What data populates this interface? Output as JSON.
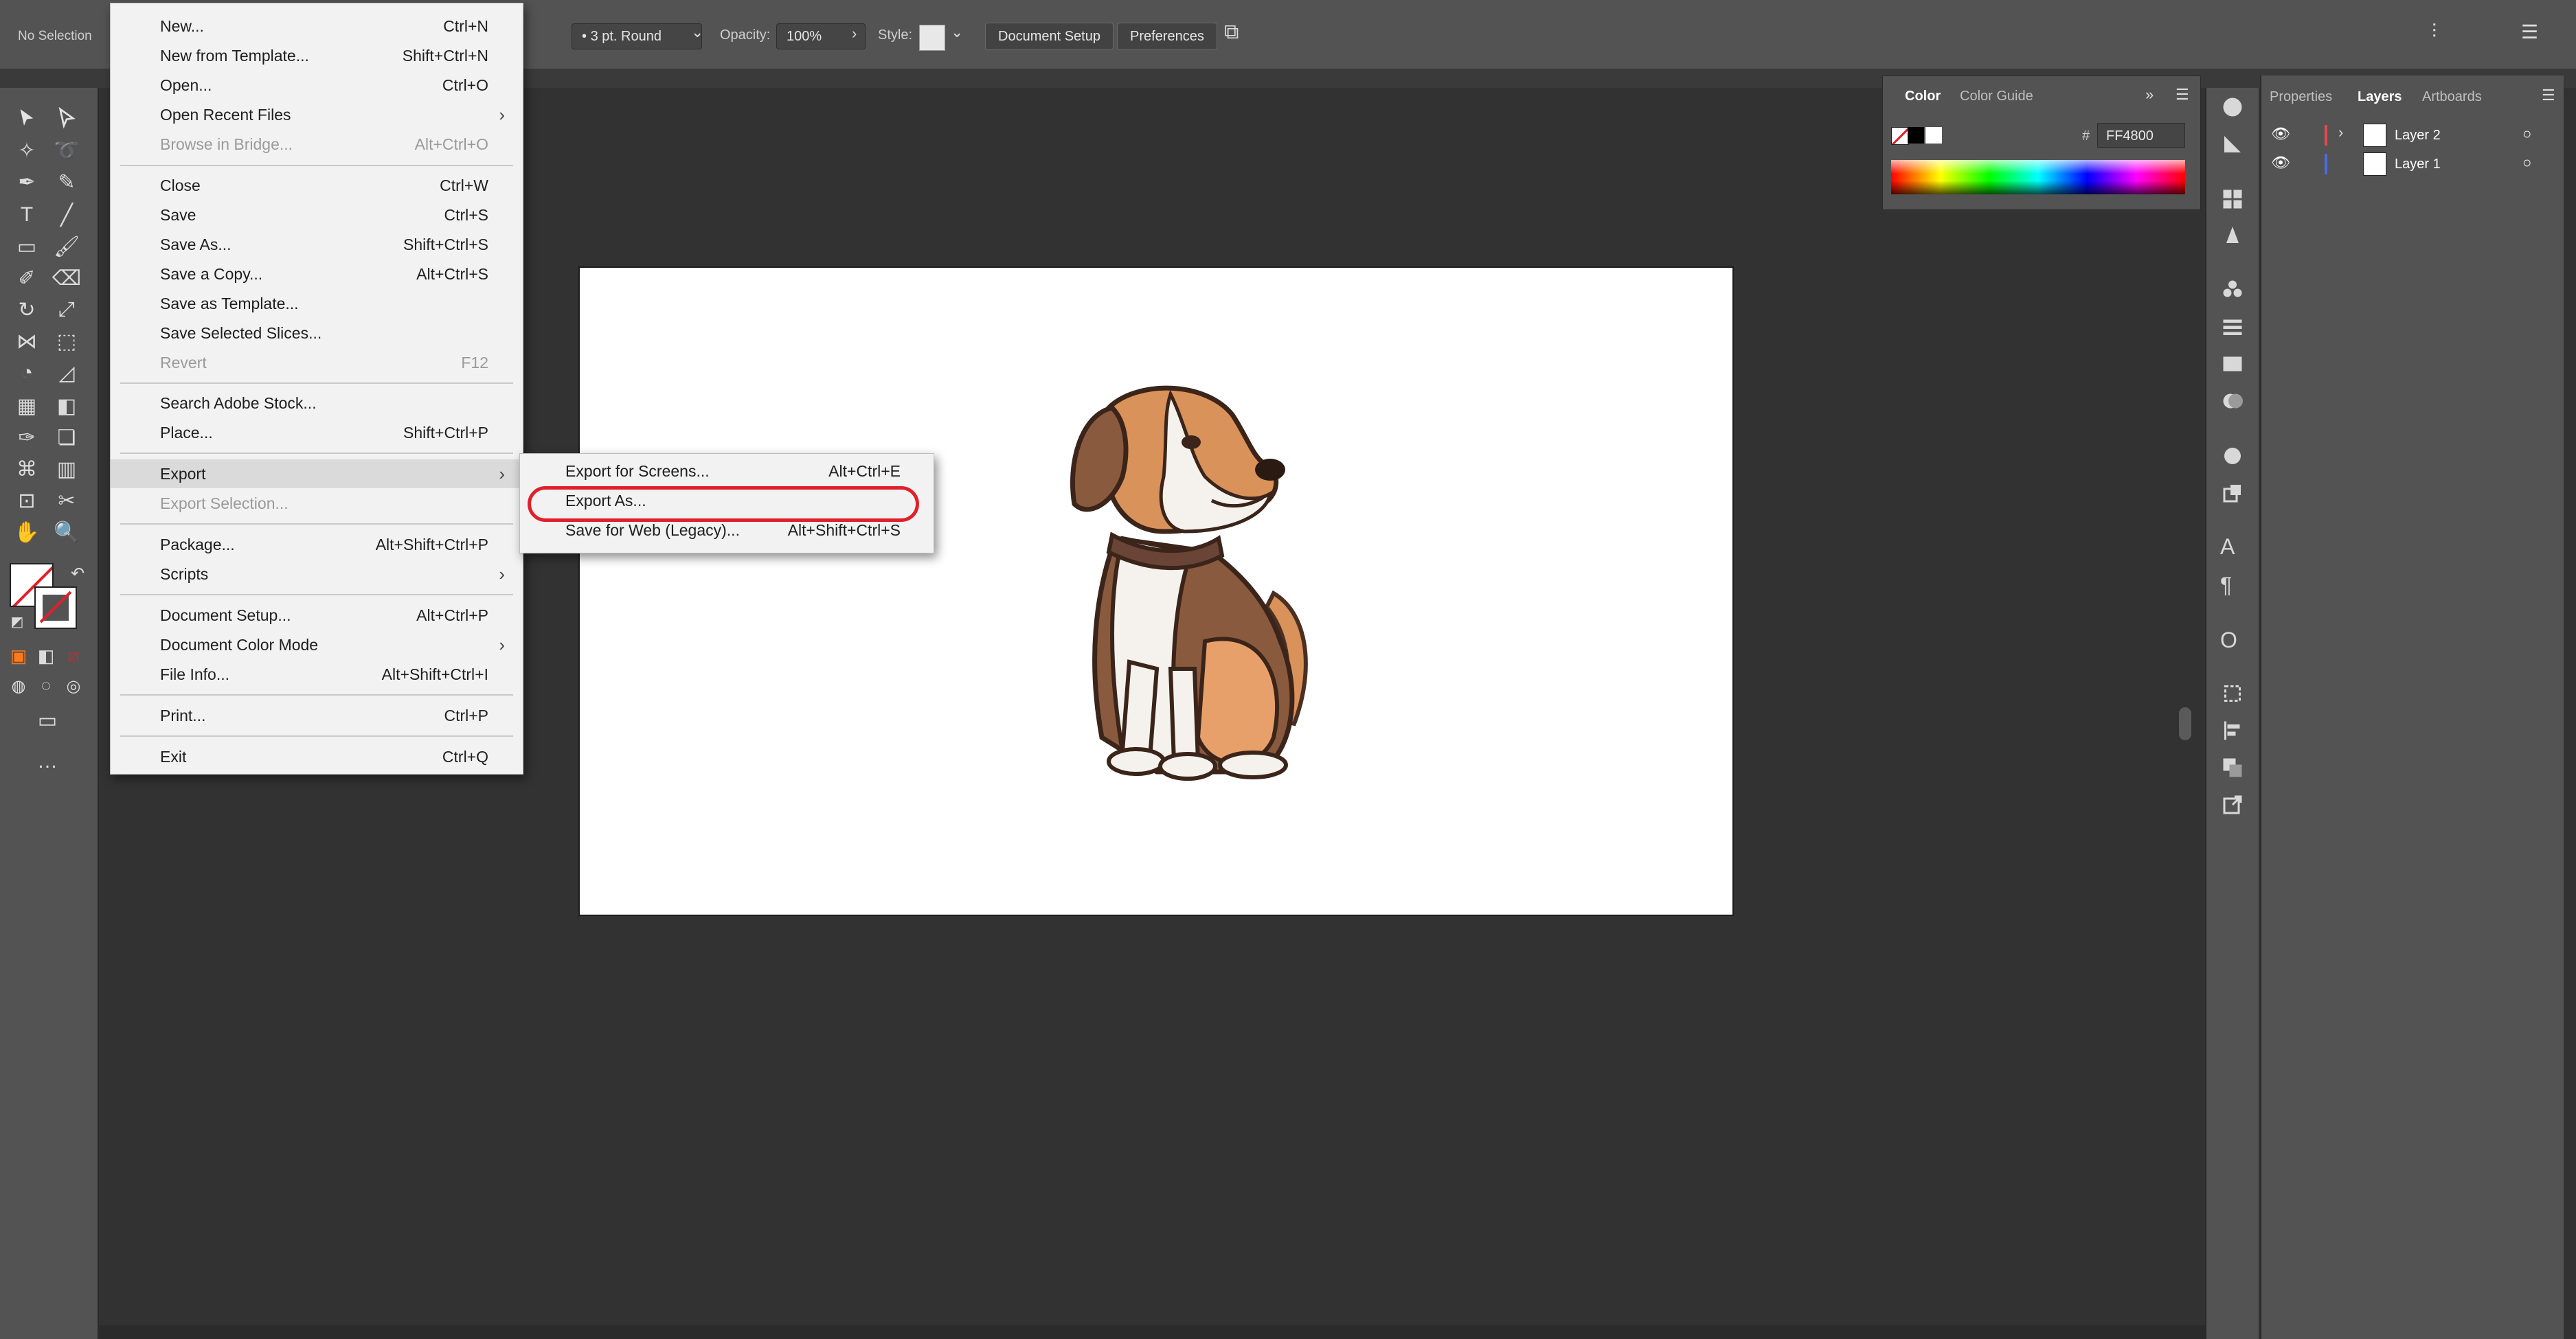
{
  "control_bar": {
    "selection": "No Selection",
    "stroke_profile": "3 pt. Round",
    "opacity_label": "Opacity:",
    "opacity_value": "100%",
    "style_label": "Style:",
    "document_setup": "Document Setup",
    "preferences": "Preferences"
  },
  "file_menu": {
    "items": [
      {
        "label": "New...",
        "shortcut": "Ctrl+N"
      },
      {
        "label": "New from Template...",
        "shortcut": "Shift+Ctrl+N"
      },
      {
        "label": "Open...",
        "shortcut": "Ctrl+O"
      },
      {
        "label": "Open Recent Files",
        "shortcut": ""
      },
      {
        "label": "Browse in Bridge...",
        "shortcut": "Alt+Ctrl+O"
      },
      {
        "label": "Close",
        "shortcut": "Ctrl+W"
      },
      {
        "label": "Save",
        "shortcut": "Ctrl+S"
      },
      {
        "label": "Save As...",
        "shortcut": "Shift+Ctrl+S"
      },
      {
        "label": "Save a Copy...",
        "shortcut": "Alt+Ctrl+S"
      },
      {
        "label": "Save as Template...",
        "shortcut": ""
      },
      {
        "label": "Save Selected Slices...",
        "shortcut": ""
      },
      {
        "label": "Revert",
        "shortcut": "F12"
      },
      {
        "label": "Search Adobe Stock...",
        "shortcut": ""
      },
      {
        "label": "Place...",
        "shortcut": "Shift+Ctrl+P"
      },
      {
        "label": "Export",
        "shortcut": ""
      },
      {
        "label": "Export Selection...",
        "shortcut": ""
      },
      {
        "label": "Package...",
        "shortcut": "Alt+Shift+Ctrl+P"
      },
      {
        "label": "Scripts",
        "shortcut": ""
      },
      {
        "label": "Document Setup...",
        "shortcut": "Alt+Ctrl+P"
      },
      {
        "label": "Document Color Mode",
        "shortcut": ""
      },
      {
        "label": "File Info...",
        "shortcut": "Alt+Shift+Ctrl+I"
      },
      {
        "label": "Print...",
        "shortcut": "Ctrl+P"
      },
      {
        "label": "Exit",
        "shortcut": "Ctrl+Q"
      }
    ]
  },
  "export_submenu": {
    "items": [
      {
        "label": "Export for Screens...",
        "shortcut": "Alt+Ctrl+E"
      },
      {
        "label": "Export As...",
        "shortcut": ""
      },
      {
        "label": "Save for Web (Legacy)...",
        "shortcut": "Alt+Shift+Ctrl+S"
      }
    ]
  },
  "color_panel": {
    "tabs": [
      "Color",
      "Color Guide"
    ],
    "hex_value": "FF4800"
  },
  "layers_panel": {
    "tabs": [
      "Properties",
      "Layers",
      "Artboards"
    ],
    "layers": [
      {
        "name": "Layer 2",
        "color": "#e24b4b"
      },
      {
        "name": "Layer 1",
        "color": "#4b6be2"
      }
    ]
  }
}
